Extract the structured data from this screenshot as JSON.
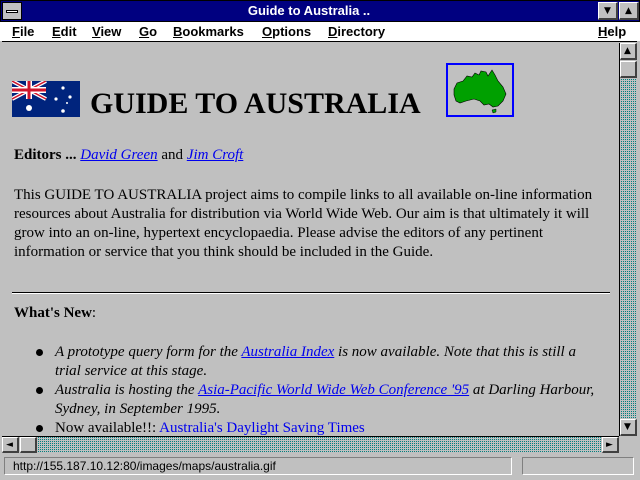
{
  "window": {
    "title": "Guide to Australia .."
  },
  "menu": {
    "items": [
      {
        "u": "F",
        "rest": "ile"
      },
      {
        "u": "E",
        "rest": "dit"
      },
      {
        "u": "V",
        "rest": "iew"
      },
      {
        "u": "G",
        "rest": "o"
      },
      {
        "u": "B",
        "rest": "ookmarks"
      },
      {
        "u": "O",
        "rest": "ptions"
      },
      {
        "u": "D",
        "rest": "irectory"
      },
      {
        "u": "H",
        "rest": "elp"
      }
    ]
  },
  "page": {
    "heading": "GUIDE TO AUSTRALIA",
    "editors_label": "Editors ...",
    "editor1": "David Green",
    "and_text": "and",
    "editor2": "Jim Croft",
    "intro": "This GUIDE TO AUSTRALIA project aims to compile links to all available on-line information resources about Australia for distribution via World Wide Web. Our aim is that ultimately it will grow into an on-line, hypertext encyclopaedia. Please advise the editors of any pertinent information or service that you think should be included in the Guide.",
    "whatsnew_label": "What's New",
    "whatsnew_colon": ":",
    "news": [
      {
        "pre": "A prototype query form for the ",
        "link": "Australia Index",
        "post": " is now available. Note that this is still a trial service at this stage."
      },
      {
        "pre": "Australia is hosting the ",
        "link": "Asia-Pacific World Wide Web Conference '95",
        "post": " at Darling Harbour, Sydney, in September 1995."
      },
      {
        "pre": "Now available!!: ",
        "link": "Australia's Daylight Saving Times",
        "post": ""
      }
    ]
  },
  "status": {
    "url": "http://155.187.10.12:80/images/maps/australia.gif"
  },
  "colors": {
    "titlebar": "#000080",
    "link": "#0000ee",
    "scroll_track": "#008080",
    "map_green": "#00a000"
  },
  "icons": {
    "flag": "australian-flag-icon",
    "map": "australia-map-icon"
  }
}
